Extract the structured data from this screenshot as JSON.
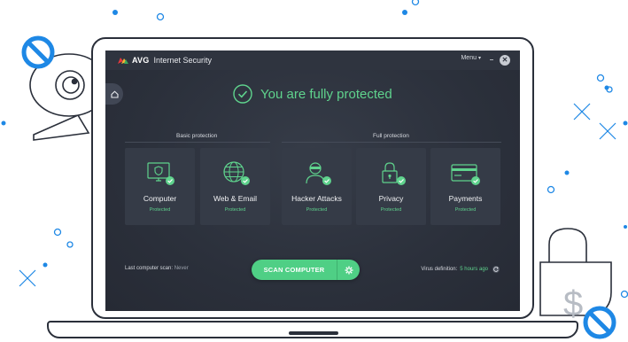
{
  "app": {
    "brand": "AVG",
    "product": "Internet Security",
    "menu_label": "Menu",
    "minimize_glyph": "–",
    "close_glyph": "✕"
  },
  "status": {
    "message": "You are fully protected",
    "color": "#5fd38d"
  },
  "groups": {
    "basic": "Basic protection",
    "full": "Full protection"
  },
  "tiles": [
    {
      "title": "Computer",
      "status": "Protected",
      "icon": "monitor-shield-icon"
    },
    {
      "title": "Web & Email",
      "status": "Protected",
      "icon": "globe-icon"
    },
    {
      "title": "Hacker Attacks",
      "status": "Protected",
      "icon": "hacker-icon"
    },
    {
      "title": "Privacy",
      "status": "Protected",
      "icon": "padlock-icon"
    },
    {
      "title": "Payments",
      "status": "Protected",
      "icon": "credit-card-icon"
    }
  ],
  "footer": {
    "last_scan_label": "Last computer scan:",
    "last_scan_value": "Never",
    "scan_button": "SCAN COMPUTER",
    "virus_def_label": "Virus definition:",
    "virus_def_value": "5 hours ago"
  },
  "colors": {
    "accent": "#4fcf85",
    "window_bg": "#2b303b",
    "tile_bg": "#353b47",
    "illustration_blue": "#1e88e5"
  }
}
